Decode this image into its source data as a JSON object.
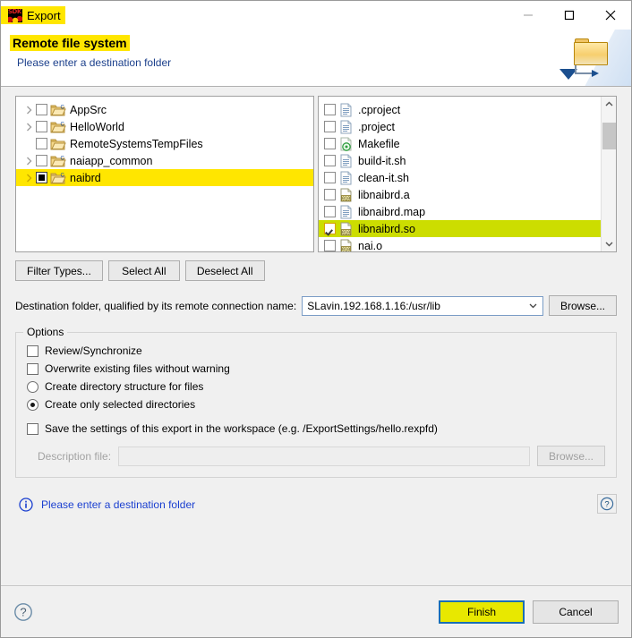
{
  "window": {
    "title": "Export",
    "icon": "sdk-icon",
    "minimize_label": "Minimize",
    "maximize_label": "Maximize",
    "close_label": "Close"
  },
  "header": {
    "title": "Remote file system",
    "subtitle": "Please enter a destination folder",
    "banner_icon": "export-folder-icon"
  },
  "tree": {
    "items": [
      {
        "label": "AppSrc",
        "twisty": true,
        "check": "unchecked",
        "icon": "c-project-folder-icon",
        "highlight": false
      },
      {
        "label": "HelloWorld",
        "twisty": true,
        "check": "unchecked",
        "icon": "c-project-folder-icon",
        "highlight": false
      },
      {
        "label": "RemoteSystemsTempFiles",
        "twisty": false,
        "check": "unchecked",
        "icon": "folder-icon",
        "highlight": false
      },
      {
        "label": "naiapp_common",
        "twisty": true,
        "check": "unchecked",
        "icon": "c-project-folder-icon",
        "highlight": false
      },
      {
        "label": "naibrd",
        "twisty": true,
        "check": "partial",
        "icon": "c-project-folder-icon",
        "highlight": true
      }
    ]
  },
  "files": {
    "items": [
      {
        "label": ".cproject",
        "check": "unchecked",
        "icon": "document-icon",
        "highlight": false
      },
      {
        "label": ".project",
        "check": "unchecked",
        "icon": "document-icon",
        "highlight": false
      },
      {
        "label": "Makefile",
        "check": "unchecked",
        "icon": "makefile-icon",
        "highlight": false
      },
      {
        "label": "build-it.sh",
        "check": "unchecked",
        "icon": "document-icon",
        "highlight": false
      },
      {
        "label": "clean-it.sh",
        "check": "unchecked",
        "icon": "document-icon",
        "highlight": false
      },
      {
        "label": "libnaibrd.a",
        "check": "unchecked",
        "icon": "binary-icon",
        "highlight": false
      },
      {
        "label": "libnaibrd.map",
        "check": "unchecked",
        "icon": "document-icon",
        "highlight": false
      },
      {
        "label": "libnaibrd.so",
        "check": "checked",
        "icon": "binary-icon",
        "highlight": true
      },
      {
        "label": "nai.o",
        "check": "unchecked",
        "icon": "binary-icon",
        "highlight": false
      }
    ],
    "scrollbar": {
      "up_icon": "chevron-up-icon",
      "down_icon": "chevron-down-icon"
    }
  },
  "selection_buttons": {
    "filter_types": "Filter Types...",
    "select_all": "Select All",
    "deselect_all": "Deselect All"
  },
  "destination": {
    "label": "Destination folder, qualified by its remote connection name:",
    "value": "SLavin.192.168.1.16:/usr/lib",
    "placeholder": "",
    "dropdown_icon": "chevron-down-icon",
    "browse_label": "Browse..."
  },
  "options": {
    "title": "Options",
    "checkboxes": [
      {
        "label": "Review/Synchronize",
        "checked": false
      },
      {
        "label": "Overwrite existing files without warning",
        "checked": false
      }
    ],
    "radios": [
      {
        "label": "Create directory structure for files",
        "selected": false
      },
      {
        "label": "Create only selected directories",
        "selected": true
      }
    ],
    "save_settings": {
      "label": "Save the settings of this export in the workspace (e.g. /ExportSettings/hello.rexpfd)",
      "checked": false
    },
    "description_file": {
      "label": "Description file:",
      "value": "",
      "placeholder": "",
      "browse_label": "Browse...",
      "disabled": true
    }
  },
  "status": {
    "icon": "info-icon",
    "text": "Please enter a destination folder",
    "help_icon": "question-mark-icon"
  },
  "footer": {
    "help_icon": "question-mark-circle-icon",
    "finish_label": "Finish",
    "cancel_label": "Cancel"
  },
  "colors": {
    "highlight_yellow": "#ffe600",
    "highlight_green": "#ccdd00",
    "link_blue": "#1a3fd0",
    "focus_blue": "#1a6fb5",
    "finish_yellow": "#e8e800",
    "dialog_bg": "#f0f0f0"
  }
}
